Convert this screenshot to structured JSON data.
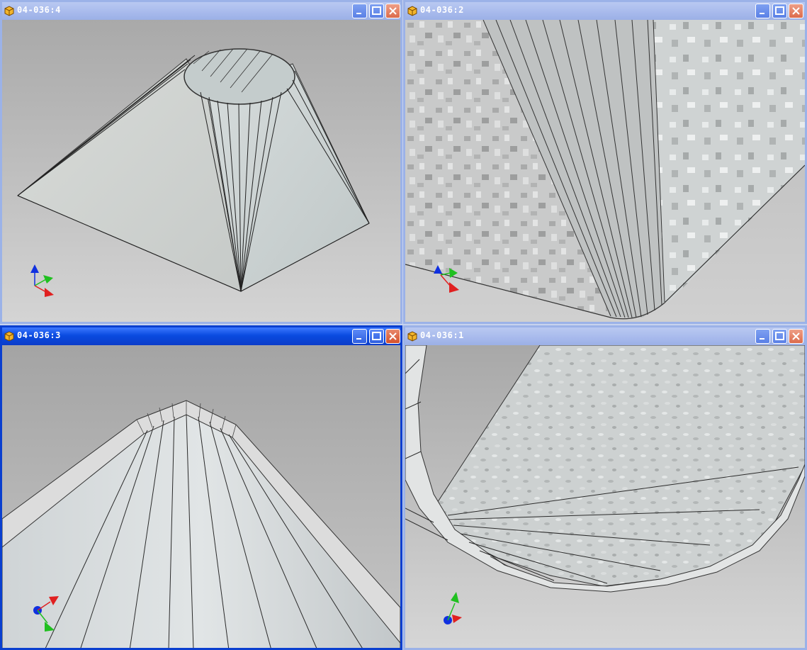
{
  "windows": [
    {
      "id": "w4",
      "title": "04-036:4",
      "active": false
    },
    {
      "id": "w2",
      "title": "04-036:2",
      "active": false
    },
    {
      "id": "w3",
      "title": "04-036:3",
      "active": true
    },
    {
      "id": "w1",
      "title": "04-036:1",
      "active": false
    }
  ],
  "buttons": {
    "minimize": "minimize-icon",
    "maximize": "maximize-icon",
    "close": "close-icon"
  },
  "colors": {
    "active_title": "#0a4be0",
    "inactive_title": "#a7b9ec",
    "viewport_bg": "#bcbcbc",
    "axis_x": "#e02020",
    "axis_y": "#20c020",
    "axis_z": "#1030e0",
    "close_button": "#d4502a"
  },
  "scene": {
    "object": "truncated-cone-transition-piece"
  }
}
